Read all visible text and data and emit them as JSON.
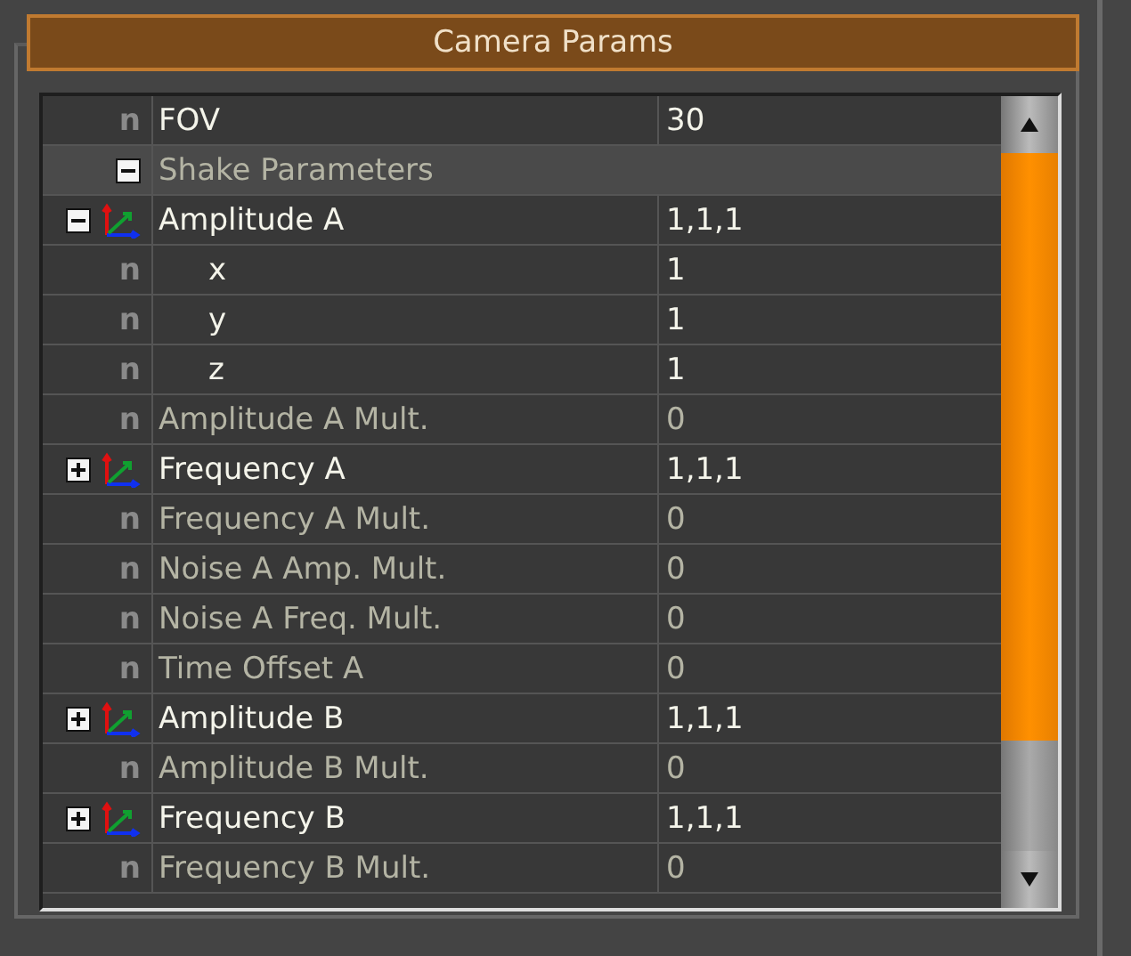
{
  "panel": {
    "title": "Camera Params"
  },
  "rows": [
    {
      "kind": "param",
      "marker": "n",
      "name": "FOV",
      "value": "30",
      "dimmed": false
    },
    {
      "kind": "group",
      "name": "Shake Parameters",
      "expanded": true,
      "dimmed": true,
      "children": [
        {
          "kind": "vector",
          "name": "Amplitude A",
          "value": "1,1,1",
          "expanded": true,
          "dimmed": false,
          "children": [
            {
              "kind": "param",
              "marker": "n",
              "name": "x",
              "value": "1",
              "dimmed": false
            },
            {
              "kind": "param",
              "marker": "n",
              "name": "y",
              "value": "1",
              "dimmed": false
            },
            {
              "kind": "param",
              "marker": "n",
              "name": "z",
              "value": "1",
              "dimmed": false
            }
          ]
        },
        {
          "kind": "param",
          "marker": "n",
          "name": "Amplitude A Mult.",
          "value": "0",
          "dimmed": true
        },
        {
          "kind": "vector",
          "name": "Frequency A",
          "value": "1,1,1",
          "expanded": false,
          "dimmed": false
        },
        {
          "kind": "param",
          "marker": "n",
          "name": "Frequency A Mult.",
          "value": "0",
          "dimmed": true
        },
        {
          "kind": "param",
          "marker": "n",
          "name": "Noise A Amp. Mult.",
          "value": "0",
          "dimmed": true
        },
        {
          "kind": "param",
          "marker": "n",
          "name": "Noise A Freq. Mult.",
          "value": "0",
          "dimmed": true
        },
        {
          "kind": "param",
          "marker": "n",
          "name": "Time Offset A",
          "value": "0",
          "dimmed": true
        },
        {
          "kind": "vector",
          "name": "Amplitude B",
          "value": "1,1,1",
          "expanded": false,
          "dimmed": false
        },
        {
          "kind": "param",
          "marker": "n",
          "name": "Amplitude B Mult.",
          "value": "0",
          "dimmed": true
        },
        {
          "kind": "vector",
          "name": "Frequency B",
          "value": "1,1,1",
          "expanded": false,
          "dimmed": false
        },
        {
          "kind": "param",
          "marker": "n",
          "name": "Frequency B Mult.",
          "value": "0",
          "dimmed": true
        }
      ]
    }
  ]
}
